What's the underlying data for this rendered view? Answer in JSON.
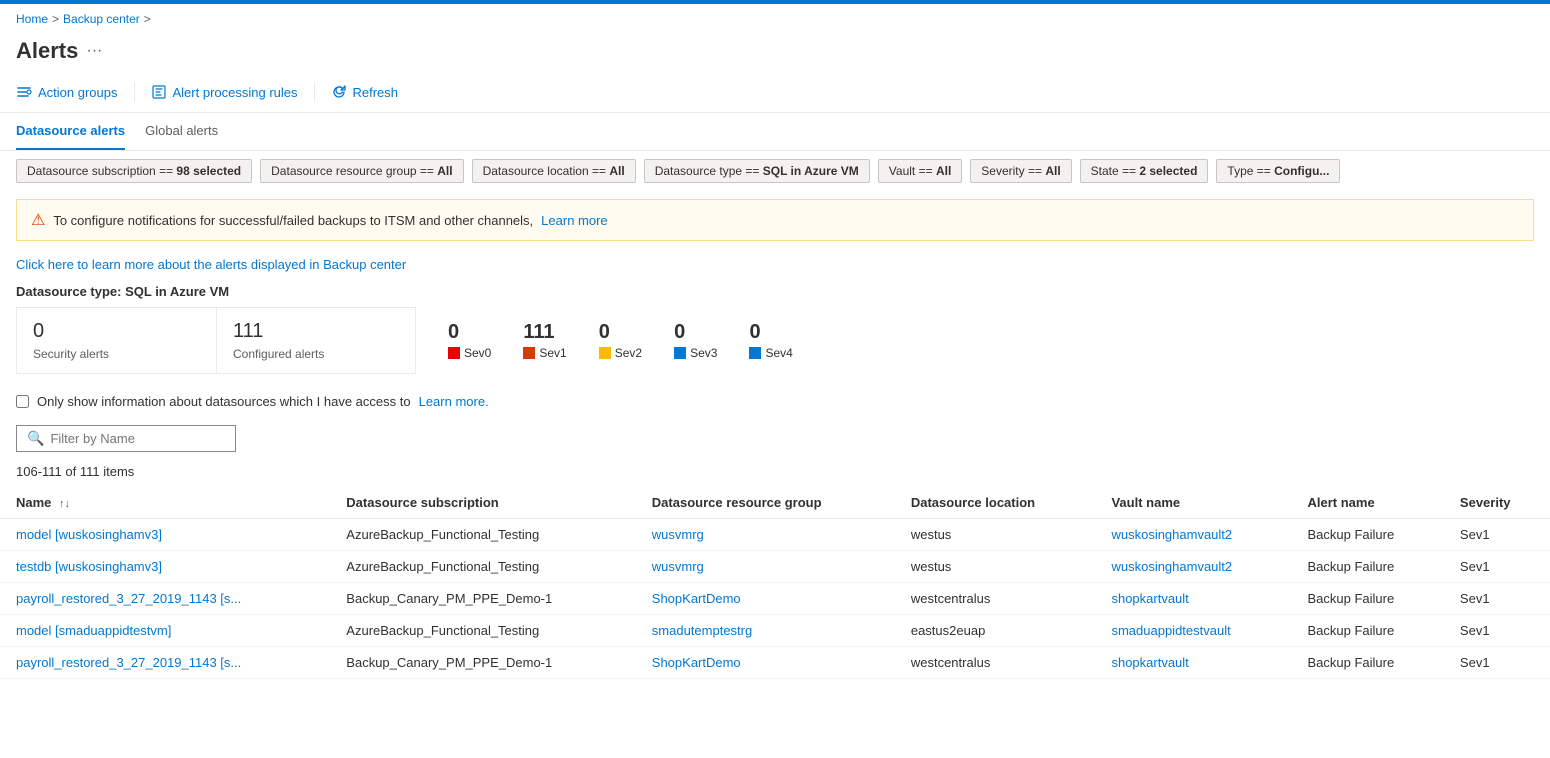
{
  "topbar": {
    "color": "#0078d4"
  },
  "breadcrumb": {
    "home": "Home",
    "separator1": ">",
    "backupCenter": "Backup center",
    "separator2": ">"
  },
  "page": {
    "title": "Alerts",
    "more_icon": "···"
  },
  "toolbar": {
    "action_groups_label": "Action groups",
    "alert_processing_rules_label": "Alert processing rules",
    "refresh_label": "Refresh"
  },
  "tabs": [
    {
      "id": "datasource",
      "label": "Datasource alerts",
      "active": true
    },
    {
      "id": "global",
      "label": "Global alerts",
      "active": false
    }
  ],
  "filters": [
    {
      "key": "Datasource subscription",
      "op": "==",
      "value": "98 selected"
    },
    {
      "key": "Datasource resource group",
      "op": "==",
      "value": "All"
    },
    {
      "key": "Datasource location",
      "op": "==",
      "value": "All"
    },
    {
      "key": "Datasource type",
      "op": "==",
      "value": "SQL in Azure VM"
    },
    {
      "key": "Vault",
      "op": "==",
      "value": "All"
    },
    {
      "key": "Severity",
      "op": "==",
      "value": "All"
    },
    {
      "key": "State",
      "op": "==",
      "value": "2 selected"
    },
    {
      "key": "Type",
      "op": "==",
      "value": "Configu..."
    }
  ],
  "warning": {
    "text": "To configure notifications for successful/failed backups to ITSM and other channels,",
    "link_label": "Learn more"
  },
  "info_link": "Click here to learn more about the alerts displayed in Backup center",
  "datasource_type_label": "Datasource type: SQL in Azure VM",
  "stats": {
    "security_count": "0",
    "security_label": "Security alerts",
    "configured_count": "111",
    "configured_label": "Configured alerts"
  },
  "severity_stats": [
    {
      "id": "sev0",
      "count": "0",
      "label": "Sev0",
      "color": "#e00"
    },
    {
      "id": "sev1",
      "count": "111",
      "label": "Sev1",
      "color": "#d83b01"
    },
    {
      "id": "sev2",
      "count": "0",
      "label": "Sev2",
      "color": "#ffb900"
    },
    {
      "id": "sev3",
      "count": "0",
      "label": "Sev3",
      "color": "#0078d4"
    },
    {
      "id": "sev4",
      "count": "0",
      "label": "Sev4",
      "color": "#0078d4"
    }
  ],
  "checkbox": {
    "label": "Only show information about datasources which I have access to",
    "link_label": "Learn more."
  },
  "search": {
    "placeholder": "Filter by Name"
  },
  "items_count": "106-111 of 111 items",
  "table": {
    "columns": [
      {
        "id": "name",
        "label": "Name",
        "sortable": true
      },
      {
        "id": "subscription",
        "label": "Datasource subscription",
        "sortable": false
      },
      {
        "id": "resource_group",
        "label": "Datasource resource group",
        "sortable": false
      },
      {
        "id": "location",
        "label": "Datasource location",
        "sortable": false
      },
      {
        "id": "vault",
        "label": "Vault name",
        "sortable": false
      },
      {
        "id": "alert_name",
        "label": "Alert name",
        "sortable": false
      },
      {
        "id": "severity",
        "label": "Severity",
        "sortable": false
      }
    ],
    "rows": [
      {
        "name": "model [wuskosinghamv3]",
        "subscription": "AzureBackup_Functional_Testing",
        "resource_group": "wusvmrg",
        "location": "westus",
        "vault": "wuskosinghamvault2",
        "alert_name": "Backup Failure",
        "severity": "Sev1"
      },
      {
        "name": "testdb [wuskosinghamv3]",
        "subscription": "AzureBackup_Functional_Testing",
        "resource_group": "wusvmrg",
        "location": "westus",
        "vault": "wuskosinghamvault2",
        "alert_name": "Backup Failure",
        "severity": "Sev1"
      },
      {
        "name": "payroll_restored_3_27_2019_1143 [s...",
        "subscription": "Backup_Canary_PM_PPE_Demo-1",
        "resource_group": "ShopKartDemo",
        "location": "westcentralus",
        "vault": "shopkartvault",
        "alert_name": "Backup Failure",
        "severity": "Sev1"
      },
      {
        "name": "model [smaduappidtestvm]",
        "subscription": "AzureBackup_Functional_Testing",
        "resource_group": "smadutemptestrg",
        "location": "eastus2euap",
        "vault": "smaduappidtestvault",
        "alert_name": "Backup Failure",
        "severity": "Sev1"
      },
      {
        "name": "payroll_restored_3_27_2019_1143 [s...",
        "subscription": "Backup_Canary_PM_PPE_Demo-1",
        "resource_group": "ShopKartDemo",
        "location": "westcentralus",
        "vault": "shopkartvault",
        "alert_name": "Backup Failure",
        "severity": "Sev1"
      }
    ]
  }
}
